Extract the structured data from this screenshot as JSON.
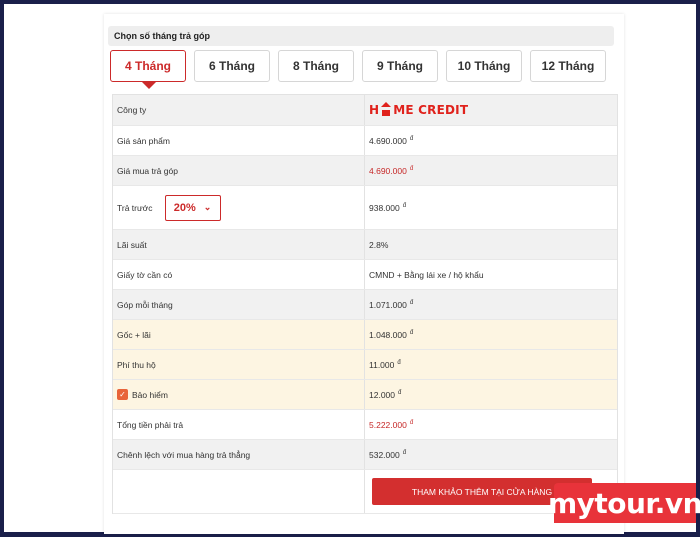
{
  "section": {
    "title": "Chọn số tháng trả góp"
  },
  "tabs": [
    {
      "label": "4 Tháng",
      "active": true
    },
    {
      "label": "6 Tháng",
      "active": false
    },
    {
      "label": "8 Tháng",
      "active": false
    },
    {
      "label": "9 Tháng",
      "active": false
    },
    {
      "label": "10 Tháng",
      "active": false
    },
    {
      "label": "12 Tháng",
      "active": false
    }
  ],
  "rows": {
    "company": {
      "label": "Công ty",
      "brand_left": "H",
      "brand_right": "ME CREDIT"
    },
    "price": {
      "label": "Giá sản phẩm",
      "value": "4.690.000",
      "currency": "đ"
    },
    "installment_price": {
      "label": "Giá mua trả góp",
      "value": "4.690.000",
      "currency": "đ"
    },
    "down_payment": {
      "label": "Trả trước",
      "percent": "20%",
      "value": "938.000",
      "currency": "đ"
    },
    "interest": {
      "label": "Lãi suất",
      "value": "2.8%"
    },
    "documents": {
      "label": "Giấy tờ cần có",
      "value": "CMND + Bằng lái xe / hộ khẩu"
    },
    "monthly": {
      "label": "Góp mỗi tháng",
      "value": "1.071.000",
      "currency": "đ"
    },
    "principal_interest": {
      "label": "Gốc + lãi",
      "value": "1.048.000",
      "currency": "đ"
    },
    "collection_fee": {
      "label": "Phí thu hộ",
      "value": "11.000",
      "currency": "đ"
    },
    "insurance": {
      "label": "Bảo hiểm",
      "checked": true,
      "value": "12.000",
      "currency": "đ"
    },
    "total": {
      "label": "Tổng tiền phải trả",
      "value": "5.222.000",
      "currency": "đ"
    },
    "difference": {
      "label": "Chênh lệch với mua hàng trả thẳng",
      "value": "532.000",
      "currency": "đ"
    }
  },
  "button": {
    "label": "THAM KHẢO THÊM TẠI CỬA HÀNG"
  },
  "watermark": {
    "text": "mytour.vn"
  },
  "colors": {
    "accent": "#cc2a2a",
    "brand": "#e0221c",
    "highlight": "#fdf5e2",
    "frame": "#1a1f4a"
  }
}
